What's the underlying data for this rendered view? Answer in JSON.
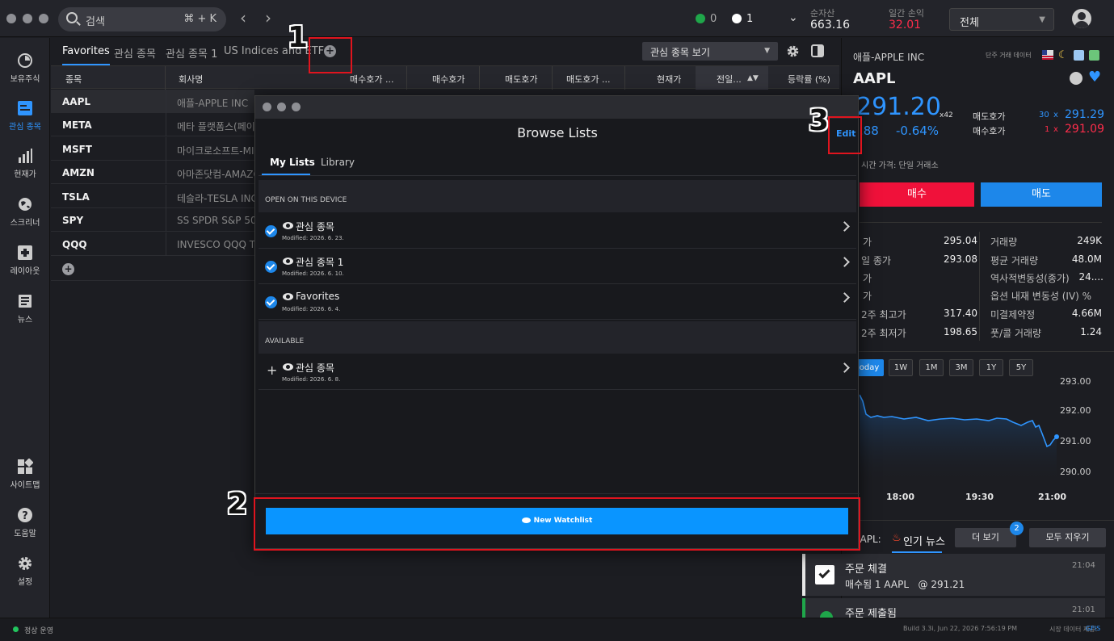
{
  "topbar": {
    "search_placeholder": "검색",
    "search_shortcut": "⌘ + K",
    "status_green_count": "0",
    "status_check_count": "1",
    "net_assets_label": "순자산",
    "net_assets_value": "663.16",
    "daily_pnl_label": "일간 손익",
    "daily_pnl_value": "32.01",
    "account_select": "전체"
  },
  "sidebar": {
    "items": [
      {
        "label": "보유주식",
        "icon": "pie-icon"
      },
      {
        "label": "관심 종목",
        "icon": "watchlist-icon"
      },
      {
        "label": "현재가",
        "icon": "bar-chart-icon"
      },
      {
        "label": "스크리너",
        "icon": "globe-icon"
      },
      {
        "label": "레이아웃",
        "icon": "layout-icon"
      },
      {
        "label": "뉴스",
        "icon": "news-icon"
      },
      {
        "label": "사이트맵",
        "icon": "grid-icon"
      },
      {
        "label": "도움말",
        "icon": "help-icon"
      },
      {
        "label": "설정",
        "icon": "gear-icon"
      }
    ]
  },
  "watchlist": {
    "tabs": [
      "Favorites",
      "관심 종목",
      "관심 종목 1",
      "US Indices and ETFs"
    ],
    "view_select": "관심 종목 보기",
    "columns": [
      "종목",
      "회사명",
      "매수호가 ...",
      "매수호가",
      "매도호가",
      "매도호가 ...",
      "현재가",
      "전일...",
      "등락률 (%)"
    ],
    "rows": [
      {
        "symbol": "AAPL",
        "name": "애플-APPLE INC"
      },
      {
        "symbol": "META",
        "name": "메타 플랫폼스(페이"
      },
      {
        "symbol": "MSFT",
        "name": "마이크로소프트-MI"
      },
      {
        "symbol": "AMZN",
        "name": "아마존닷컴-AMAZO"
      },
      {
        "symbol": "TSLA",
        "name": "테슬라-TESLA INC"
      },
      {
        "symbol": "SPY",
        "name": "SS SPDR S&P 500"
      },
      {
        "symbol": "QQQ",
        "name": "INVESCO QQQ TR"
      }
    ]
  },
  "quote": {
    "company": "애플-APPLE INC",
    "feed_label": "단주 거래 데이터",
    "symbol": "AAPL",
    "price": "291.20",
    "multiplier": "x42",
    "change": ".88",
    "change_pct": "-0.64%",
    "ask_label": "매도호가",
    "ask_size": "30",
    "ask_price": "291.29",
    "bid_label": "매수호가",
    "bid_size": "1",
    "bid_price": "291.09",
    "x_char": "x",
    "realtime_note": "시간 가격: 단일 거래소",
    "buy_label": "매수",
    "sell_label": "매도",
    "stats_left": [
      {
        "label": "가",
        "value": "295.04"
      },
      {
        "label": "일 종가",
        "value": "293.08"
      },
      {
        "label": "가",
        "value": ""
      },
      {
        "label": "가",
        "value": ""
      },
      {
        "label": "2주 최고가",
        "value": "317.40"
      },
      {
        "label": "2주 최저가",
        "value": "198.65"
      }
    ],
    "stats_right": [
      {
        "label": "거래량",
        "value": "249K"
      },
      {
        "label": "평균 거래량",
        "value": "48.0M"
      },
      {
        "label": "역사적변동성(종가)",
        "value": "24...."
      },
      {
        "label": "옵션 내재 변동성 (IV) %",
        "value": ""
      },
      {
        "label": "미결제약정",
        "value": "4.66M"
      },
      {
        "label": "풋/콜 거래량",
        "value": "1.24"
      }
    ],
    "timeframes": [
      "oday",
      "1W",
      "1M",
      "3M",
      "1Y",
      "5Y"
    ],
    "chart_y_ticks": [
      "293.00",
      "292.00",
      "291.00",
      "290.00"
    ],
    "chart_x_ticks": [
      "18:00",
      "19:30",
      "21:00"
    ],
    "news_symbol": "AAPL:",
    "news_tab": "인기 뉴스",
    "more_label": "더 보기",
    "more_badge": "2",
    "clear_all_label": "모두 지우기"
  },
  "notifications": [
    {
      "title": "주문 체결",
      "time": "21:04",
      "detail": "매수됨 1 AAPL   @ 291.21"
    },
    {
      "title": "주문 제출됨",
      "time": "21:01",
      "detail": ""
    }
  ],
  "modal": {
    "title": "Browse Lists",
    "edit_label": "Edit",
    "tabs": [
      "My Lists",
      "Library"
    ],
    "open_header": "OPEN ON THIS DEVICE",
    "available_header": "AVAILABLE",
    "open_lists": [
      {
        "name": "관심 종목",
        "modified": "Modified: 2026. 6. 23."
      },
      {
        "name": "관심 종목 1",
        "modified": "Modified: 2026. 6. 10."
      },
      {
        "name": "Favorites",
        "modified": "Modified: 2026. 6. 4."
      }
    ],
    "available_lists": [
      {
        "name": "관심 종목",
        "modified": "Modified: 2026. 6. 8."
      }
    ],
    "new_watchlist_label": "New Watchlist"
  },
  "annotations": [
    "1",
    "2",
    "3"
  ],
  "statusbar": {
    "status": "정상 운영",
    "build": "Build 3.3i, Jun 22, 2026 7:56:19 PM",
    "data_label": "시장 데이터 제공:",
    "data_provider": "GFIS"
  },
  "colors": {
    "accent": "#2f95ff",
    "buy": "#f0113a",
    "sell": "#1d87ea",
    "annotation": "#e0141e"
  }
}
